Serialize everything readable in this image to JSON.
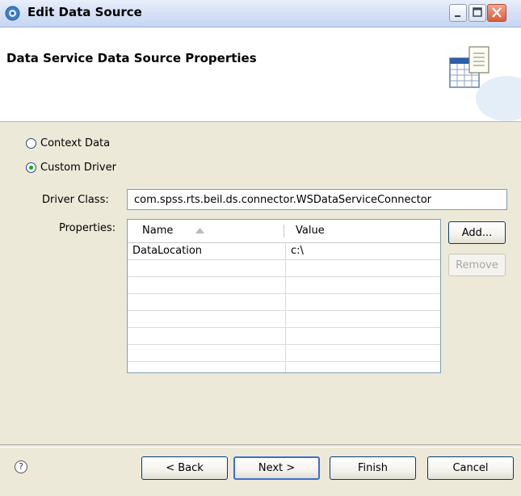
{
  "window": {
    "title": "Edit Data Source",
    "controls": {
      "minimize": "minimize",
      "maximize": "maximize",
      "close": "close"
    }
  },
  "header": {
    "title": "Data Service Data Source Properties",
    "graphic_icon": "table-document-icon"
  },
  "source_type": {
    "options": [
      {
        "label": "Context Data",
        "selected": false
      },
      {
        "label": "Custom Driver",
        "selected": true
      }
    ]
  },
  "driver_class": {
    "label": "Driver Class:",
    "value": "com.spss.rts.beil.ds.connector.WSDataServiceConnector"
  },
  "properties": {
    "label": "Properties:",
    "columns": [
      "Name",
      "Value"
    ],
    "sort_icon": "sort-ascending-icon",
    "rows": [
      {
        "name": "DataLocation",
        "value": "c:\\"
      },
      {
        "name": "",
        "value": ""
      },
      {
        "name": "",
        "value": ""
      },
      {
        "name": "",
        "value": ""
      },
      {
        "name": "",
        "value": ""
      },
      {
        "name": "",
        "value": ""
      },
      {
        "name": "",
        "value": ""
      },
      {
        "name": "",
        "value": ""
      }
    ],
    "add_label": "Add...",
    "remove_label": "Remove"
  },
  "footer": {
    "help_icon": "?",
    "back_label": "< Back",
    "next_label": "Next >",
    "finish_label": "Finish",
    "cancel_label": "Cancel"
  },
  "colors": {
    "titlebar": "#D6E2F7",
    "dialog_bg": "#ECE9D8",
    "radio_selected": "#21A121",
    "default_button_border": "#3C6ED0"
  }
}
